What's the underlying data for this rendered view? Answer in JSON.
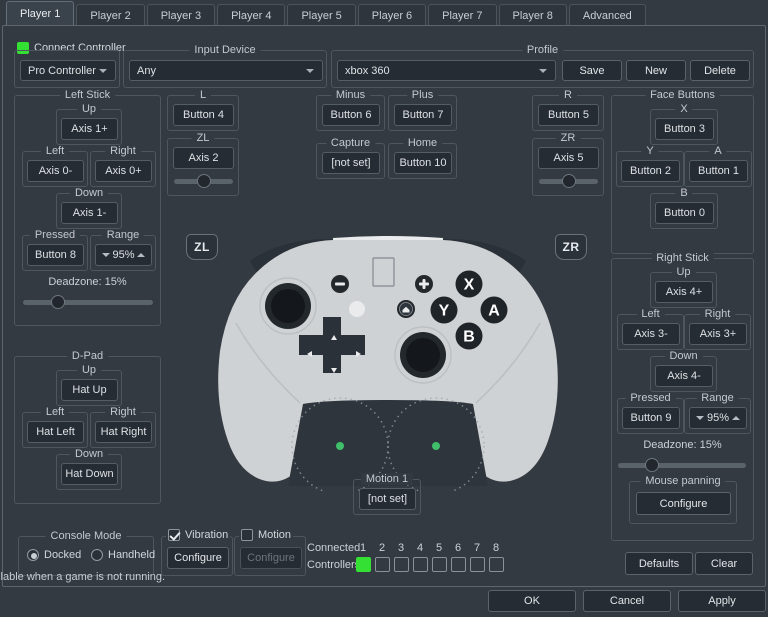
{
  "tabs": [
    {
      "label": "Player 1",
      "active": true
    },
    {
      "label": "Player 2",
      "active": false
    },
    {
      "label": "Player 3",
      "active": false
    },
    {
      "label": "Player 4",
      "active": false
    },
    {
      "label": "Player 5",
      "active": false
    },
    {
      "label": "Player 6",
      "active": false
    },
    {
      "label": "Player 7",
      "active": false
    },
    {
      "label": "Player 8",
      "active": false
    },
    {
      "label": "Advanced",
      "active": false
    }
  ],
  "top": {
    "connect_controller_label": "Connect Controller",
    "controller_type": "Pro Controller",
    "input_device_group": "Input Device",
    "input_device_value": "Any",
    "profile_group": "Profile",
    "profile_value": "xbox 360",
    "save_label": "Save",
    "new_label": "New",
    "delete_label": "Delete"
  },
  "left_stick": {
    "group": "Left Stick",
    "up_label": "Up",
    "up_value": "Axis 1+",
    "left_label": "Left",
    "left_value": "Axis 0-",
    "right_label": "Right",
    "right_value": "Axis 0+",
    "down_label": "Down",
    "down_value": "Axis 1-",
    "pressed_label": "Pressed",
    "pressed_value": "Button 8",
    "range_label": "Range",
    "range_value": "95%",
    "deadzone_text": "Deadzone: 15%",
    "deadzone_percent": 15
  },
  "right_stick": {
    "group": "Right Stick",
    "up_label": "Up",
    "up_value": "Axis 4+",
    "left_label": "Left",
    "left_value": "Axis 3-",
    "right_label": "Right",
    "right_value": "Axis 3+",
    "down_label": "Down",
    "down_value": "Axis 4-",
    "pressed_label": "Pressed",
    "pressed_value": "Button 9",
    "range_label": "Range",
    "range_value": "95%",
    "deadzone_text": "Deadzone: 15%",
    "deadzone_percent": 15,
    "mouse_panning_label": "Mouse panning",
    "mouse_panning_button": "Configure"
  },
  "dpad": {
    "group": "D-Pad",
    "up_label": "Up",
    "up_value": "Hat Up",
    "left_label": "Left",
    "left_value": "Hat Left",
    "right_label": "Right",
    "right_value": "Hat Right",
    "down_label": "Down",
    "down_value": "Hat Down"
  },
  "shoulders": {
    "l_label": "L",
    "l_value": "Button 4",
    "zl_label": "ZL",
    "zl_value": "Axis 2",
    "zl_slider_percent": 50,
    "r_label": "R",
    "r_value": "Button 5",
    "zr_label": "ZR",
    "zr_value": "Axis 5",
    "zr_slider_percent": 50
  },
  "system_buttons": {
    "minus_label": "Minus",
    "minus_value": "Button 6",
    "plus_label": "Plus",
    "plus_value": "Button 7",
    "capture_label": "Capture",
    "capture_value": "[not set]",
    "home_label": "Home",
    "home_value": "Button 10"
  },
  "face_buttons": {
    "group": "Face Buttons",
    "x_label": "X",
    "x_value": "Button 3",
    "y_label": "Y",
    "y_value": "Button 2",
    "a_label": "A",
    "a_value": "Button 1",
    "b_label": "B",
    "b_value": "Button 0"
  },
  "motion": {
    "label": "Motion 1",
    "value": "[not set]"
  },
  "bottom": {
    "console_mode_group": "Console Mode",
    "docked_label": "Docked",
    "docked_selected": true,
    "handheld_label": "Handheld",
    "handheld_selected": false,
    "vibration_label": "Vibration",
    "vibration_checked": true,
    "vibration_configure": "Configure",
    "motion_label": "Motion",
    "motion_checked": false,
    "motion_configure": "Configure",
    "connected_label_line1": "Connected",
    "connected_label_line2": "Controllers",
    "controller_numbers": [
      "1",
      "2",
      "3",
      "4",
      "5",
      "6",
      "7",
      "8"
    ],
    "controller_states": [
      true,
      false,
      false,
      false,
      false,
      false,
      false,
      false
    ],
    "defaults_label": "Defaults",
    "clear_label": "Clear"
  },
  "statusbar": {
    "text": "ailable when a game is not running."
  },
  "dialog": {
    "ok_label": "OK",
    "cancel_label": "Cancel",
    "apply_label": "Apply"
  },
  "controller_art": {
    "zl_trigger_label": "ZL",
    "zr_trigger_label": "ZR",
    "face_x": "X",
    "face_y": "Y",
    "face_a": "A",
    "face_b": "B"
  },
  "colors": {
    "accent_green": "#35e035",
    "background": "#333a42",
    "panel": "#2e353c",
    "field": "#262c33",
    "border": "#4e565e",
    "text": "#d6dade",
    "controller_body": "#cfd2d4"
  }
}
